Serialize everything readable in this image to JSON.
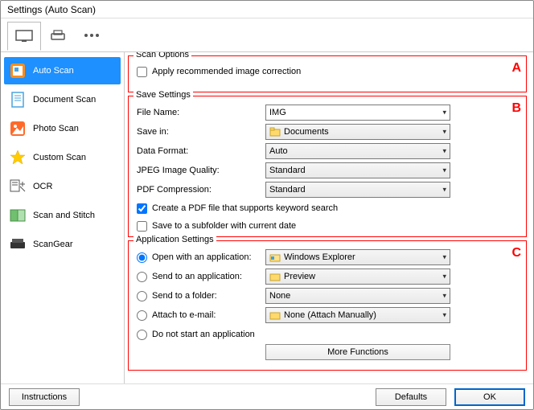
{
  "window": {
    "title": "Settings (Auto Scan)"
  },
  "sidebar": {
    "items": [
      {
        "label": "Auto Scan"
      },
      {
        "label": "Document Scan"
      },
      {
        "label": "Photo Scan"
      },
      {
        "label": "Custom Scan"
      },
      {
        "label": "OCR"
      },
      {
        "label": "Scan and Stitch"
      },
      {
        "label": "ScanGear"
      }
    ]
  },
  "scan_options": {
    "legend": "Scan Options",
    "marker": "A",
    "apply_correction_label": "Apply recommended image correction"
  },
  "save_settings": {
    "legend": "Save Settings",
    "marker": "B",
    "file_name_label": "File Name:",
    "file_name_value": "IMG",
    "save_in_label": "Save in:",
    "save_in_value": "Documents",
    "data_format_label": "Data Format:",
    "data_format_value": "Auto",
    "jpeg_quality_label": "JPEG Image Quality:",
    "jpeg_quality_value": "Standard",
    "pdf_compression_label": "PDF Compression:",
    "pdf_compression_value": "Standard",
    "create_pdf_label": "Create a PDF file that supports keyword search",
    "save_subfolder_label": "Save to a subfolder with current date"
  },
  "app_settings": {
    "legend": "Application Settings",
    "marker": "C",
    "open_app_label": "Open with an application:",
    "open_app_value": "Windows Explorer",
    "send_app_label": "Send to an application:",
    "send_app_value": "Preview",
    "send_folder_label": "Send to a folder:",
    "send_folder_value": "None",
    "attach_email_label": "Attach to e-mail:",
    "attach_email_value": "None (Attach Manually)",
    "do_not_start_label": "Do not start an application",
    "more_functions_label": "More Functions"
  },
  "footer": {
    "instructions": "Instructions",
    "defaults": "Defaults",
    "ok": "OK"
  }
}
